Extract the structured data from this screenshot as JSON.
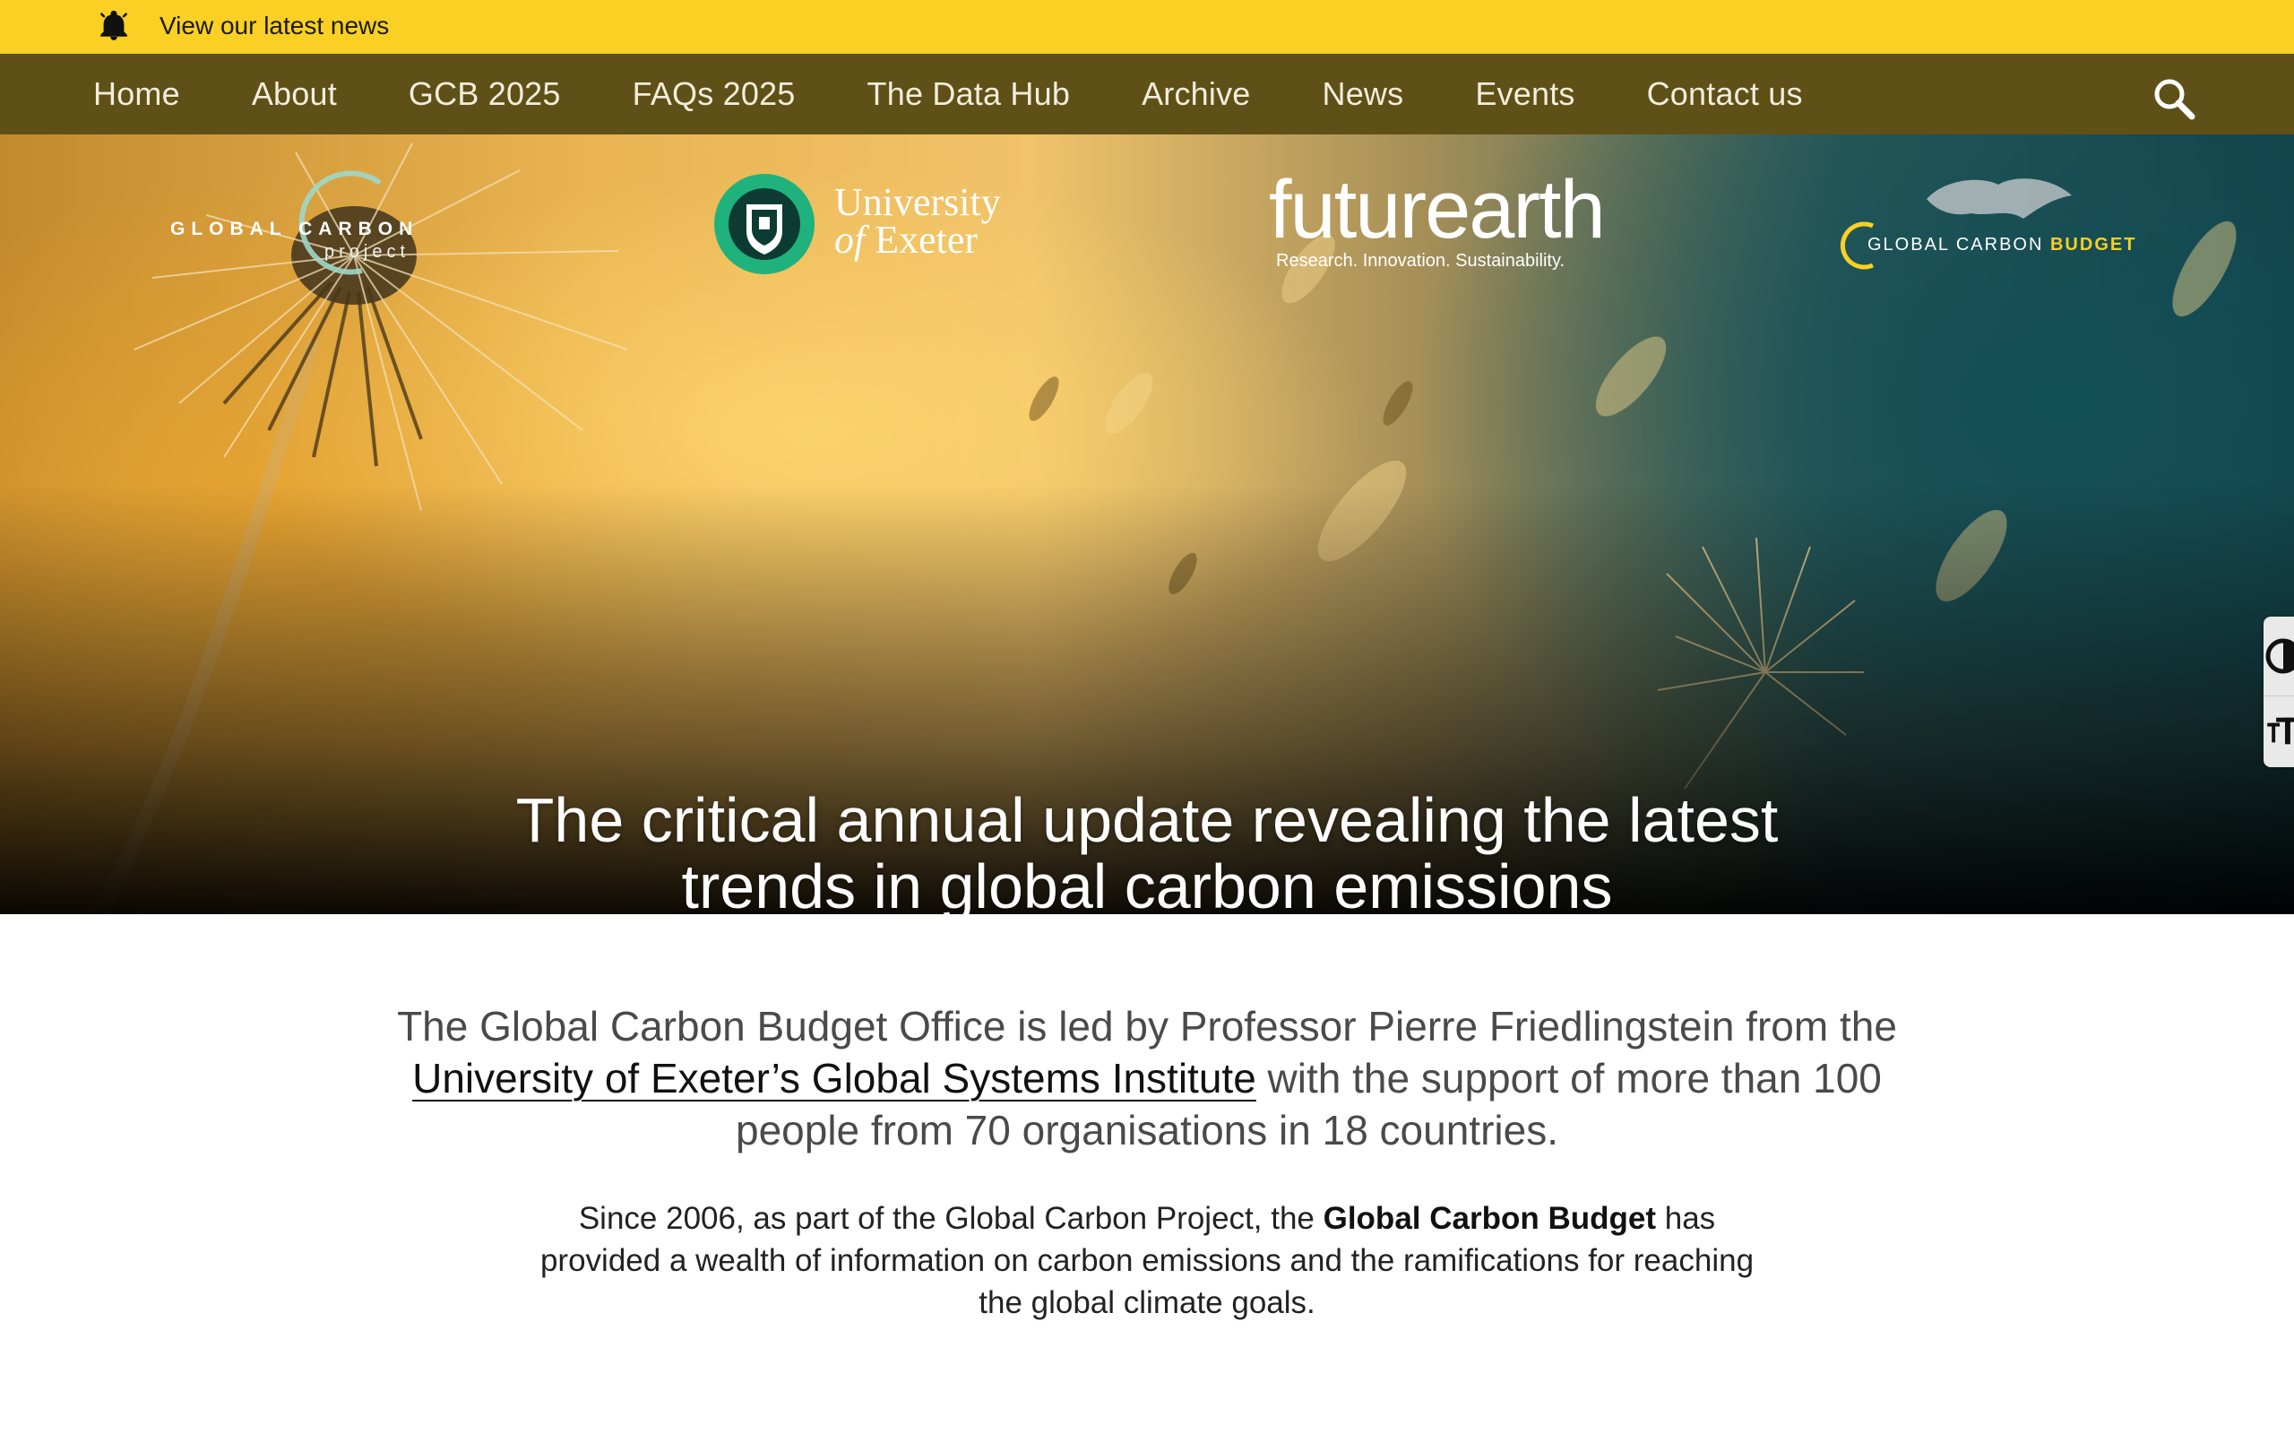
{
  "news_bar": {
    "icon": "bell-icon",
    "link_text": "View our latest news",
    "background": "#f9d023"
  },
  "nav": {
    "background": "#5f5018",
    "items": [
      {
        "label": "Home"
      },
      {
        "label": "About"
      },
      {
        "label": "GCB 2025"
      },
      {
        "label": "FAQs 2025"
      },
      {
        "label": "The Data Hub"
      },
      {
        "label": "Archive"
      },
      {
        "label": "News"
      },
      {
        "label": "Events"
      },
      {
        "label": "Contact us"
      }
    ],
    "search_icon": "search-icon"
  },
  "hero": {
    "logos": {
      "gcp": {
        "line1": "GLOBAL CARBON",
        "line2": "project"
      },
      "exeter": {
        "line1": "University",
        "line2_italic": "of",
        "line2_rest": " Exeter"
      },
      "futurearth": {
        "word": "futurearth",
        "tagline": "Research. Innovation. Sustainability."
      },
      "gcb": {
        "part1": "GLOBAL CARBON",
        "part2": "BUDGET"
      }
    },
    "headline": "The critical annual update revealing the latest trends in global carbon emissions"
  },
  "accessibility": {
    "contrast_icon": "contrast-icon",
    "text_size_icon": "text-size-icon"
  },
  "intro": {
    "before_link": "The Global Carbon Budget Office is led by Professor Pierre Friedlingstein from the ",
    "link_text": "University of Exeter’s Global Systems Institute",
    "after_link": " with the support of more than 100 people from 70 organisations in 18 countries."
  },
  "sub": {
    "before_bold": "Since 2006, as part of the Global Carbon Project, the ",
    "bold": "Global Carbon Budget",
    "after_bold": " has provided a wealth of information on carbon emissions and the ramifications for reaching the global climate goals."
  },
  "colors": {
    "accent_yellow": "#f9d023",
    "nav_olive": "#5f5018",
    "hero_teal": "#123f46"
  }
}
